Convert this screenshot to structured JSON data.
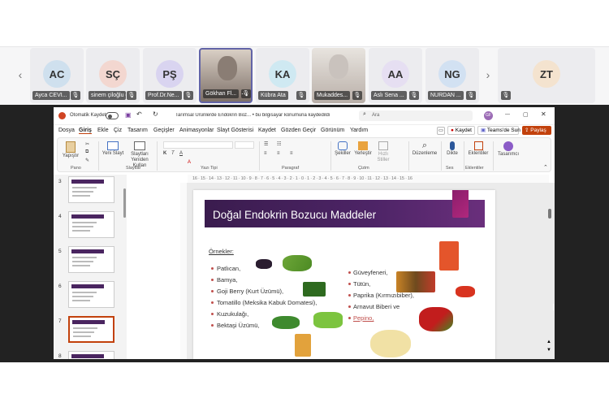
{
  "meeting": {
    "participants": [
      {
        "initials": "AC",
        "name": "Ayca CEVI...",
        "color": "#cfe0ee"
      },
      {
        "initials": "SÇ",
        "name": "sinem çiloğlu (...",
        "color": "#f3d7d0"
      },
      {
        "initials": "PŞ",
        "name": "Prof.Dr.Ne...",
        "color": "#d9d4f0"
      },
      {
        "initials": "",
        "name": "Gökhan Fl...",
        "color": "#8a7d74"
      },
      {
        "initials": "KA",
        "name": "Kübra Ata",
        "color": "#cfe9f2"
      },
      {
        "initials": "",
        "name": "Mukaddes...",
        "color": "#c9c2bd"
      },
      {
        "initials": "AA",
        "name": "Aslı Sena ...",
        "color": "#e6dff2"
      },
      {
        "initials": "NG",
        "name": "NURDAN ...",
        "color": "#d2e1f2"
      },
      {
        "initials": "ZT",
        "name": "",
        "color": "#f4e3cf"
      }
    ]
  },
  "ppt": {
    "autosave": "Otomatik Kaydet",
    "file_title": "Tarımsal Ürünlerde Endokrin Boz... • bu bilgisayar konumuna kaydedildi",
    "search_placeholder": "Ara",
    "user_initials": "GF",
    "menu": [
      "Dosya",
      "Giriş",
      "Ekle",
      "Çiz",
      "Tasarım",
      "Geçişler",
      "Animasyonlar",
      "Slayt Gösterisi",
      "Kaydet",
      "Gözden Geçir",
      "Görünüm",
      "Yardım"
    ],
    "record_btn": "Kaydet",
    "teams_btn": "Teams'de Sun",
    "share_btn": "Paylaş",
    "ribbon": {
      "paste": "Yapıştır",
      "new_slide": "Yeni Slayt",
      "slides": "Slaytları Yeniden Kullan",
      "shapes": "Şekiller",
      "arrange": "Yerleştir",
      "quick_styles": "Hızlı Stiller",
      "editing": "Düzenleme",
      "dictate": "Dikte",
      "addins": "Eklentiler",
      "designer": "Tasarımcı",
      "groups": [
        "Pano",
        "Slaytlar",
        "Yazı Tipi",
        "Paragraf",
        "Çizim",
        "Ses",
        "Eklentiler"
      ]
    },
    "ruler": "16 · 15 · 14 · 13 · 12 · 11 · 10 · 9 · 8 · 7 · 6 · 5 · 4 · 3 · 2 · 1 · 0 · 1 · 2 · 3 · 4 · 5 · 6 · 7 · 8 · 9 · 10 · 11 · 12 · 13 · 14 · 15 · 16",
    "thumb_numbers": [
      "3",
      "4",
      "5",
      "6",
      "7",
      "8"
    ],
    "slide": {
      "title": "Doğal Endokrin Bozucu Maddeler",
      "examples_label": "Örnekler:",
      "left_items": [
        "Patlıcan,",
        "Bamya,",
        "Goji Berry (Kurt Üzümü),",
        "Tomatillo (Meksika Kabuk Domatesi),",
        "Kuzukulağı,",
        "Bektaşi Üzümü,"
      ],
      "right_items": [
        "Güveyfeneri,",
        "Tütün,",
        "Paprika (Kırmızıbiber),",
        "Arnavut Biberi ve",
        "Pepino,"
      ]
    }
  }
}
